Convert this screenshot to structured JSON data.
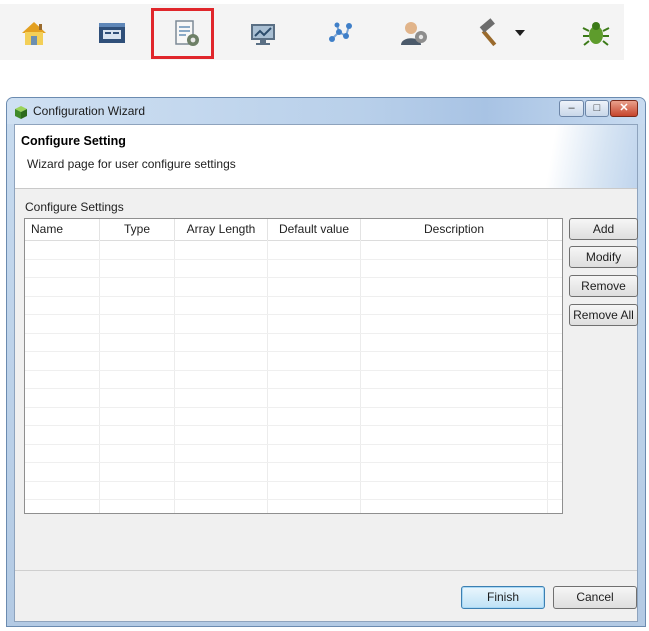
{
  "toolbar": {
    "buttons": [
      {
        "icon": "home-icon"
      },
      {
        "icon": "window-settings-icon"
      },
      {
        "icon": "configuration-document-gear-icon",
        "highlighted": true
      },
      {
        "icon": "monitor-icon"
      },
      {
        "icon": "network-nodes-icon"
      },
      {
        "icon": "user-gear-icon"
      },
      {
        "icon": "hammer-build-icon",
        "has_dropdown": true
      },
      {
        "icon": "bug-debug-icon"
      }
    ],
    "highlight_color": "#e0262b"
  },
  "window": {
    "title": "Configuration Wizard",
    "controls": {
      "minimize": "–",
      "maximize": "□",
      "close": "✕"
    }
  },
  "header": {
    "title": "Configure Setting",
    "description": "Wizard page for user configure settings"
  },
  "settings": {
    "label": "Configure Settings",
    "columns": [
      "Name",
      "Type",
      "Array Length",
      "Default value",
      "Description"
    ],
    "rows": []
  },
  "actions": {
    "add": "Add",
    "modify": "Modify",
    "remove": "Remove",
    "remove_all": "Remove All"
  },
  "footer": {
    "finish": "Finish",
    "cancel": "Cancel"
  }
}
